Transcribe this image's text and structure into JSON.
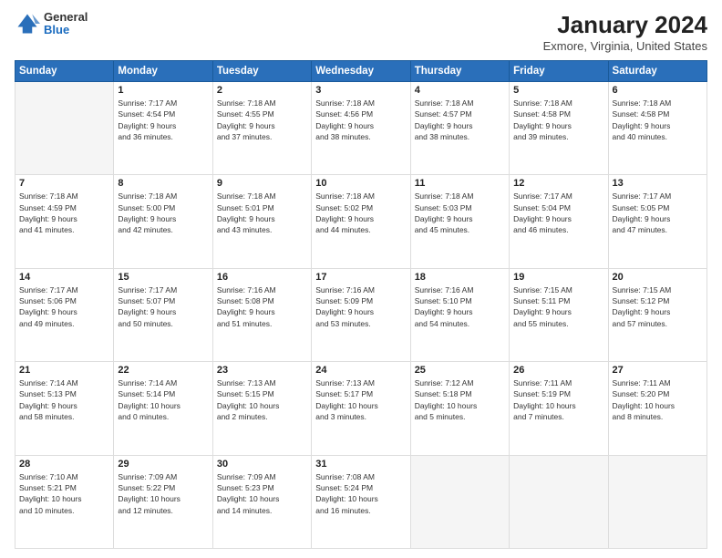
{
  "header": {
    "title": "January 2024",
    "subtitle": "Exmore, Virginia, United States",
    "logo_general": "General",
    "logo_blue": "Blue"
  },
  "days_of_week": [
    "Sunday",
    "Monday",
    "Tuesday",
    "Wednesday",
    "Thursday",
    "Friday",
    "Saturday"
  ],
  "weeks": [
    [
      {
        "day": "",
        "info": ""
      },
      {
        "day": "1",
        "info": "Sunrise: 7:17 AM\nSunset: 4:54 PM\nDaylight: 9 hours\nand 36 minutes."
      },
      {
        "day": "2",
        "info": "Sunrise: 7:18 AM\nSunset: 4:55 PM\nDaylight: 9 hours\nand 37 minutes."
      },
      {
        "day": "3",
        "info": "Sunrise: 7:18 AM\nSunset: 4:56 PM\nDaylight: 9 hours\nand 38 minutes."
      },
      {
        "day": "4",
        "info": "Sunrise: 7:18 AM\nSunset: 4:57 PM\nDaylight: 9 hours\nand 38 minutes."
      },
      {
        "day": "5",
        "info": "Sunrise: 7:18 AM\nSunset: 4:58 PM\nDaylight: 9 hours\nand 39 minutes."
      },
      {
        "day": "6",
        "info": "Sunrise: 7:18 AM\nSunset: 4:58 PM\nDaylight: 9 hours\nand 40 minutes."
      }
    ],
    [
      {
        "day": "7",
        "info": "Sunrise: 7:18 AM\nSunset: 4:59 PM\nDaylight: 9 hours\nand 41 minutes."
      },
      {
        "day": "8",
        "info": "Sunrise: 7:18 AM\nSunset: 5:00 PM\nDaylight: 9 hours\nand 42 minutes."
      },
      {
        "day": "9",
        "info": "Sunrise: 7:18 AM\nSunset: 5:01 PM\nDaylight: 9 hours\nand 43 minutes."
      },
      {
        "day": "10",
        "info": "Sunrise: 7:18 AM\nSunset: 5:02 PM\nDaylight: 9 hours\nand 44 minutes."
      },
      {
        "day": "11",
        "info": "Sunrise: 7:18 AM\nSunset: 5:03 PM\nDaylight: 9 hours\nand 45 minutes."
      },
      {
        "day": "12",
        "info": "Sunrise: 7:17 AM\nSunset: 5:04 PM\nDaylight: 9 hours\nand 46 minutes."
      },
      {
        "day": "13",
        "info": "Sunrise: 7:17 AM\nSunset: 5:05 PM\nDaylight: 9 hours\nand 47 minutes."
      }
    ],
    [
      {
        "day": "14",
        "info": "Sunrise: 7:17 AM\nSunset: 5:06 PM\nDaylight: 9 hours\nand 49 minutes."
      },
      {
        "day": "15",
        "info": "Sunrise: 7:17 AM\nSunset: 5:07 PM\nDaylight: 9 hours\nand 50 minutes."
      },
      {
        "day": "16",
        "info": "Sunrise: 7:16 AM\nSunset: 5:08 PM\nDaylight: 9 hours\nand 51 minutes."
      },
      {
        "day": "17",
        "info": "Sunrise: 7:16 AM\nSunset: 5:09 PM\nDaylight: 9 hours\nand 53 minutes."
      },
      {
        "day": "18",
        "info": "Sunrise: 7:16 AM\nSunset: 5:10 PM\nDaylight: 9 hours\nand 54 minutes."
      },
      {
        "day": "19",
        "info": "Sunrise: 7:15 AM\nSunset: 5:11 PM\nDaylight: 9 hours\nand 55 minutes."
      },
      {
        "day": "20",
        "info": "Sunrise: 7:15 AM\nSunset: 5:12 PM\nDaylight: 9 hours\nand 57 minutes."
      }
    ],
    [
      {
        "day": "21",
        "info": "Sunrise: 7:14 AM\nSunset: 5:13 PM\nDaylight: 9 hours\nand 58 minutes."
      },
      {
        "day": "22",
        "info": "Sunrise: 7:14 AM\nSunset: 5:14 PM\nDaylight: 10 hours\nand 0 minutes."
      },
      {
        "day": "23",
        "info": "Sunrise: 7:13 AM\nSunset: 5:15 PM\nDaylight: 10 hours\nand 2 minutes."
      },
      {
        "day": "24",
        "info": "Sunrise: 7:13 AM\nSunset: 5:17 PM\nDaylight: 10 hours\nand 3 minutes."
      },
      {
        "day": "25",
        "info": "Sunrise: 7:12 AM\nSunset: 5:18 PM\nDaylight: 10 hours\nand 5 minutes."
      },
      {
        "day": "26",
        "info": "Sunrise: 7:11 AM\nSunset: 5:19 PM\nDaylight: 10 hours\nand 7 minutes."
      },
      {
        "day": "27",
        "info": "Sunrise: 7:11 AM\nSunset: 5:20 PM\nDaylight: 10 hours\nand 8 minutes."
      }
    ],
    [
      {
        "day": "28",
        "info": "Sunrise: 7:10 AM\nSunset: 5:21 PM\nDaylight: 10 hours\nand 10 minutes."
      },
      {
        "day": "29",
        "info": "Sunrise: 7:09 AM\nSunset: 5:22 PM\nDaylight: 10 hours\nand 12 minutes."
      },
      {
        "day": "30",
        "info": "Sunrise: 7:09 AM\nSunset: 5:23 PM\nDaylight: 10 hours\nand 14 minutes."
      },
      {
        "day": "31",
        "info": "Sunrise: 7:08 AM\nSunset: 5:24 PM\nDaylight: 10 hours\nand 16 minutes."
      },
      {
        "day": "",
        "info": ""
      },
      {
        "day": "",
        "info": ""
      },
      {
        "day": "",
        "info": ""
      }
    ]
  ]
}
